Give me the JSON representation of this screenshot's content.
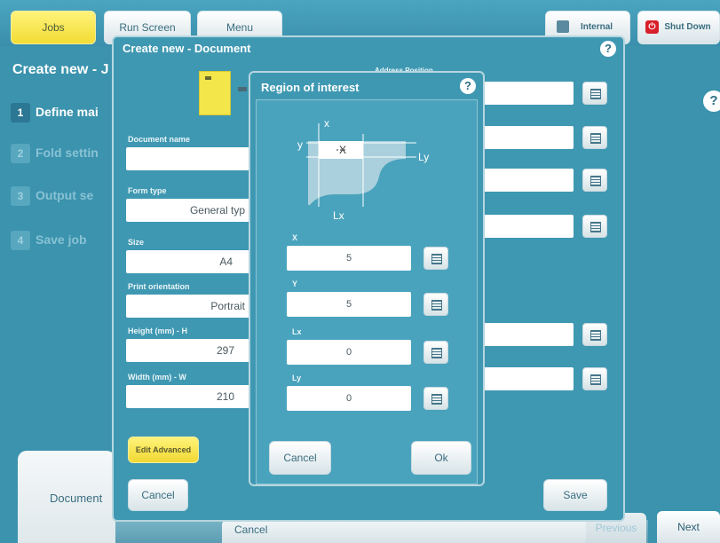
{
  "topbar": {
    "jobs": "Jobs",
    "run_screen": "Run Screen",
    "menu": "Menu",
    "internal": "Internal",
    "shut_down": "Shut Down"
  },
  "background": {
    "title": "Create new - J",
    "help": "?",
    "steps": [
      {
        "num": "1",
        "label": "Define mai"
      },
      {
        "num": "2",
        "label": "Fold settin"
      },
      {
        "num": "3",
        "label": "Output se"
      },
      {
        "num": "4",
        "label": "Save job"
      }
    ],
    "document_tab": "Document",
    "cancel": "Cancel",
    "previous": "Previous",
    "next": "Next"
  },
  "create_dialog": {
    "title": "Create new - Document",
    "help": "?",
    "address_position_label": "Address Position",
    "fields": {
      "document_name": {
        "label": "Document name",
        "value": ""
      },
      "form_type": {
        "label": "Form type",
        "value": "General typ"
      },
      "size": {
        "label": "Size",
        "value": "A4"
      },
      "print_orientation": {
        "label": "Print orientation",
        "value": "Portrait"
      },
      "height": {
        "label": "Height (mm) - H",
        "value": "297"
      },
      "width": {
        "label": "Width (mm) - W",
        "value": "210"
      }
    },
    "edit_advanced": "Edit Advanced",
    "cancel": "Cancel",
    "save": "Save"
  },
  "roi_dialog": {
    "title": "Region of interest",
    "help": "?",
    "diagram": {
      "x": "x",
      "y": "y",
      "lx": "Lx",
      "ly": "Ly",
      "mark": "X"
    },
    "fields": [
      {
        "label": "X",
        "value": "5"
      },
      {
        "label": "Y",
        "value": "5"
      },
      {
        "label": "Lx",
        "value": "0"
      },
      {
        "label": "Ly",
        "value": "0"
      }
    ],
    "cancel": "Cancel",
    "ok": "Ok"
  },
  "colors": {
    "background": "#3b93ae",
    "accent_yellow": "#f2dc35",
    "shutdown_red": "#d8202a"
  }
}
